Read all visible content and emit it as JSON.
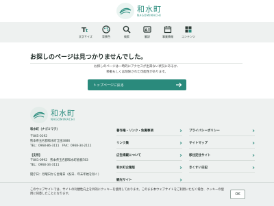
{
  "site": {
    "logo_text": "和水町",
    "logo_sub": "NAGOMIMACHI"
  },
  "nav": [
    {
      "label": "文字サイズ",
      "icon": "text-size-icon"
    },
    {
      "label": "背景色",
      "icon": "palette-icon"
    },
    {
      "label": "検索",
      "icon": "search-icon"
    },
    {
      "label": "翻訳",
      "icon": "translate-icon"
    },
    {
      "label": "事業情報",
      "icon": "calendar-icon"
    },
    {
      "label": "コンテンツ",
      "icon": "grid-icon"
    }
  ],
  "main": {
    "title": "お探しのページは見つかりませんでした。",
    "message_line1": "お探しのページは一時的にアクセスが出来ない状況にあるか、",
    "message_line2": "移動もしくは削除された可能性があります。",
    "top_button": "トップページに戻る"
  },
  "footer": {
    "office_name": "和水町（ナゴミマチ）",
    "postal": "〒865-0192",
    "address": "熊本県玉名郡和水町江田3886",
    "phone_fax": "TEL：0968-86-3111　FAX：0968-34-2111",
    "branch_title": "【支所】",
    "branch_address": "〒861-0992　熊本県玉名郡和水町板楠783",
    "branch_tel": "TEL：0968-34-3111",
    "hours": "開庁日：月曜日から金曜日（祝日、年末年始を除く）",
    "links_col1": [
      "著作権・リンク・免責事項",
      "リンク集",
      "広告掲載について",
      "和水町企業版",
      "観光サイト"
    ],
    "links_col2": [
      "プライバシーポリシー",
      "サイトマップ",
      "移住定住サイト",
      "きくすい日記"
    ]
  },
  "cookie": {
    "text": "このウェブサイトでは、サイトの利便性向上を目的にクッキーを使用しております。このまま本ウェブサイトをご利用いただく場合、クッキーの使用に同意したことになります。",
    "ok_label": "OK"
  },
  "colors": {
    "accent": "#2a8a7c",
    "nav_bg": "#eef1f0",
    "footer_bg": "#eef1f0"
  }
}
